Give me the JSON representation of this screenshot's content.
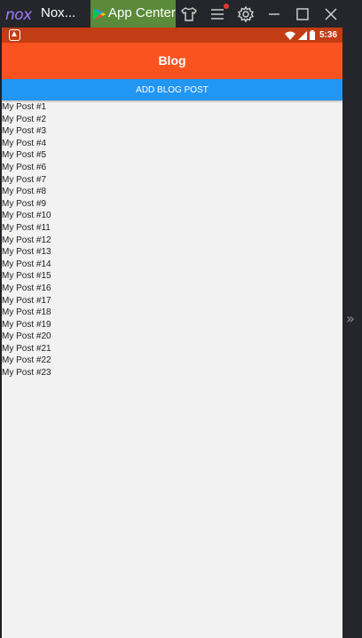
{
  "emulator": {
    "logo_text": "nox",
    "window_title": "Nox...",
    "tab_label": "App Center",
    "side_chevron": "»"
  },
  "status_bar": {
    "time": "5:36"
  },
  "app": {
    "title": "Blog",
    "add_button_label": "ADD BLOG POST",
    "posts": [
      "My Post #1",
      "My Post #2",
      "My Post #3",
      "My Post #4",
      "My Post #5",
      "My Post #6",
      "My Post #7",
      "My Post #8",
      "My Post #9",
      "My Post #10",
      "My Post #11",
      "My Post #12",
      "My Post #13",
      "My Post #14",
      "My Post #15",
      "My Post #16",
      "My Post #17",
      "My Post #18",
      "My Post #19",
      "My Post #20",
      "My Post #21",
      "My Post #22",
      "My Post #23"
    ]
  },
  "colors": {
    "header": "#fb531f",
    "status_bar": "#c23d13",
    "button": "#2196f3",
    "background": "#f2f2f2"
  }
}
